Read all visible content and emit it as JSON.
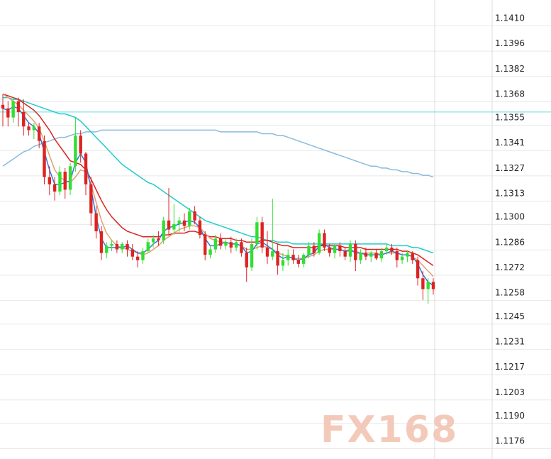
{
  "chart_data": {
    "type": "candlestick",
    "title": "",
    "ylabel": "",
    "xlabel": "",
    "ylim": [
      1.1166,
      1.142
    ],
    "y_ticks": [
      "1.1410",
      "1.1396",
      "1.1382",
      "1.1368",
      "1.1355",
      "1.1341",
      "1.1327",
      "1.1313",
      "1.1300",
      "1.1286",
      "1.1272",
      "1.1258",
      "1.1245",
      "1.1231",
      "1.1217",
      "1.1203",
      "1.1190",
      "1.1176"
    ],
    "grid": true,
    "reference_line": 1.1358,
    "colors": {
      "up": "#33dd33",
      "down": "#dd2222",
      "ma_fast": "#3377dd",
      "ma_mid": "#e0a070",
      "ma_slow": "#dd2222",
      "ma_cyan": "#22cccc",
      "ma_long": "#88bbdd",
      "grid": "#e8e8e8",
      "axis": "#e0e0e0",
      "ref_line": "#66dddd"
    },
    "candles": [
      [
        1.1362,
        1.1368,
        1.135,
        1.136
      ],
      [
        1.136,
        1.1364,
        1.135,
        1.1355
      ],
      [
        1.1355,
        1.1366,
        1.1352,
        1.1364
      ],
      [
        1.1364,
        1.1366,
        1.135,
        1.1358
      ],
      [
        1.1358,
        1.1365,
        1.1345,
        1.135
      ],
      [
        1.135,
        1.1352,
        1.1345,
        1.1348
      ],
      [
        1.1348,
        1.1352,
        1.1343,
        1.135
      ],
      [
        1.135,
        1.1352,
        1.1338,
        1.1342
      ],
      [
        1.1342,
        1.1345,
        1.1318,
        1.1322
      ],
      [
        1.1322,
        1.1328,
        1.1312,
        1.1318
      ],
      [
        1.1318,
        1.1322,
        1.1309,
        1.1314
      ],
      [
        1.1314,
        1.1328,
        1.1312,
        1.1325
      ],
      [
        1.1325,
        1.1327,
        1.131,
        1.1315
      ],
      [
        1.1315,
        1.133,
        1.1312,
        1.1328
      ],
      [
        1.1328,
        1.1355,
        1.1325,
        1.1345
      ],
      [
        1.1345,
        1.1348,
        1.133,
        1.1335
      ],
      [
        1.1335,
        1.1336,
        1.1312,
        1.1318
      ],
      [
        1.1318,
        1.1322,
        1.1295,
        1.1302
      ],
      [
        1.1302,
        1.1306,
        1.1288,
        1.1292
      ],
      [
        1.1292,
        1.1295,
        1.1276,
        1.128
      ],
      [
        1.128,
        1.1286,
        1.1277,
        1.1284
      ],
      [
        1.1284,
        1.1287,
        1.1281,
        1.1285
      ],
      [
        1.1285,
        1.1287,
        1.128,
        1.1282
      ],
      [
        1.1282,
        1.1286,
        1.128,
        1.1285
      ],
      [
        1.1285,
        1.1287,
        1.1278,
        1.1282
      ],
      [
        1.1282,
        1.1285,
        1.1276,
        1.1278
      ],
      [
        1.1278,
        1.1281,
        1.1272,
        1.1276
      ],
      [
        1.1276,
        1.1283,
        1.1274,
        1.1281
      ],
      [
        1.1281,
        1.1288,
        1.128,
        1.1286
      ],
      [
        1.1286,
        1.129,
        1.1283,
        1.1288
      ],
      [
        1.1288,
        1.1292,
        1.1284,
        1.1287
      ],
      [
        1.1287,
        1.13,
        1.1285,
        1.1298
      ],
      [
        1.1298,
        1.1316,
        1.129,
        1.1293
      ],
      [
        1.1293,
        1.1307,
        1.129,
        1.1296
      ],
      [
        1.1296,
        1.13,
        1.1291,
        1.1298
      ],
      [
        1.1298,
        1.1302,
        1.1292,
        1.1295
      ],
      [
        1.1295,
        1.1305,
        1.1293,
        1.1303
      ],
      [
        1.1303,
        1.1306,
        1.1296,
        1.1298
      ],
      [
        1.1298,
        1.13,
        1.1288,
        1.129
      ],
      [
        1.129,
        1.1292,
        1.1276,
        1.1279
      ],
      [
        1.1279,
        1.1284,
        1.1277,
        1.1282
      ],
      [
        1.1282,
        1.129,
        1.128,
        1.1288
      ],
      [
        1.1288,
        1.1291,
        1.1282,
        1.1284
      ],
      [
        1.1284,
        1.1288,
        1.1282,
        1.1286
      ],
      [
        1.1286,
        1.1289,
        1.128,
        1.1283
      ],
      [
        1.1283,
        1.1288,
        1.1281,
        1.1286
      ],
      [
        1.1286,
        1.1288,
        1.1278,
        1.128
      ],
      [
        1.128,
        1.1283,
        1.1264,
        1.1272
      ],
      [
        1.1272,
        1.1288,
        1.127,
        1.1285
      ],
      [
        1.1285,
        1.13,
        1.1282,
        1.1297
      ],
      [
        1.1297,
        1.13,
        1.128,
        1.1283
      ],
      [
        1.1283,
        1.1292,
        1.1274,
        1.1278
      ],
      [
        1.1278,
        1.131,
        1.1276,
        1.1281
      ],
      [
        1.1281,
        1.1285,
        1.1268,
        1.1273
      ],
      [
        1.1273,
        1.128,
        1.127,
        1.1276
      ],
      [
        1.1276,
        1.1282,
        1.1273,
        1.1279
      ],
      [
        1.1279,
        1.1282,
        1.1274,
        1.1276
      ],
      [
        1.1276,
        1.1279,
        1.1272,
        1.1274
      ],
      [
        1.1274,
        1.128,
        1.1272,
        1.1279
      ],
      [
        1.1279,
        1.1286,
        1.1277,
        1.1284
      ],
      [
        1.1284,
        1.1286,
        1.1278,
        1.128
      ],
      [
        1.128,
        1.1293,
        1.1279,
        1.1291
      ],
      [
        1.1291,
        1.1293,
        1.1281,
        1.1283
      ],
      [
        1.1283,
        1.1285,
        1.1278,
        1.128
      ],
      [
        1.128,
        1.1285,
        1.1277,
        1.1284
      ],
      [
        1.1284,
        1.1286,
        1.1278,
        1.1281
      ],
      [
        1.1281,
        1.1283,
        1.1276,
        1.1278
      ],
      [
        1.1278,
        1.1287,
        1.1275,
        1.1285
      ],
      [
        1.1285,
        1.1287,
        1.127,
        1.1276
      ],
      [
        1.1276,
        1.1282,
        1.1274,
        1.128
      ],
      [
        1.128,
        1.1283,
        1.1276,
        1.1278
      ],
      [
        1.1278,
        1.1281,
        1.1275,
        1.128
      ],
      [
        1.128,
        1.1282,
        1.1276,
        1.1277
      ],
      [
        1.1277,
        1.1283,
        1.1275,
        1.1281
      ],
      [
        1.1281,
        1.1285,
        1.1279,
        1.1283
      ],
      [
        1.1283,
        1.1285,
        1.1279,
        1.1281
      ],
      [
        1.1281,
        1.1283,
        1.1272,
        1.1276
      ],
      [
        1.1276,
        1.128,
        1.1274,
        1.1278
      ],
      [
        1.1278,
        1.1281,
        1.1275,
        1.128
      ],
      [
        1.128,
        1.1281,
        1.1274,
        1.1276
      ],
      [
        1.1276,
        1.1278,
        1.1262,
        1.1266
      ],
      [
        1.1266,
        1.127,
        1.1254,
        1.126
      ],
      [
        1.126,
        1.1266,
        1.1252,
        1.1264
      ],
      [
        1.1264,
        1.1266,
        1.1257,
        1.126
      ]
    ],
    "ma_fast": [
      1.136,
      1.1359,
      1.1361,
      1.136,
      1.1356,
      1.1352,
      1.135,
      1.1346,
      1.1336,
      1.1326,
      1.1318,
      1.1318,
      1.1319,
      1.132,
      1.133,
      1.1335,
      1.133,
      1.1316,
      1.13,
      1.1288,
      1.1283,
      1.1283,
      1.1283,
      1.1283,
      1.1284,
      1.1282,
      1.128,
      1.128,
      1.1282,
      1.1285,
      1.1287,
      1.1292,
      1.1294,
      1.1295,
      1.1296,
      1.1297,
      1.1298,
      1.1297,
      1.1294,
      1.1288,
      1.1284,
      1.1284,
      1.1285,
      1.1286,
      1.1285,
      1.1285,
      1.1284,
      1.128,
      1.1281,
      1.1285,
      1.1286,
      1.1284,
      1.1282,
      1.1279,
      1.1277,
      1.1278,
      1.1277,
      1.1276,
      1.1277,
      1.1279,
      1.128,
      1.1284,
      1.1285,
      1.1283,
      1.1282,
      1.1282,
      1.1281,
      1.1282,
      1.128,
      1.128,
      1.1279,
      1.1279,
      1.1279,
      1.1279,
      1.128,
      1.1281,
      1.128,
      1.1279,
      1.1279,
      1.1278,
      1.1274,
      1.1268,
      1.1264,
      1.1262
    ],
    "ma_mid": [
      1.1368,
      1.1366,
      1.1364,
      1.1362,
      1.1359,
      1.1356,
      1.1353,
      1.1349,
      1.1342,
      1.1334,
      1.1326,
      1.1322,
      1.132,
      1.1319,
      1.1322,
      1.1326,
      1.1325,
      1.1318,
      1.1308,
      1.1298,
      1.1291,
      1.1287,
      1.1284,
      1.1283,
      1.1282,
      1.1281,
      1.128,
      1.1279,
      1.128,
      1.1282,
      1.1284,
      1.1287,
      1.1289,
      1.1291,
      1.1293,
      1.1294,
      1.1295,
      1.1295,
      1.1294,
      1.1291,
      1.1288,
      1.1287,
      1.1286,
      1.1286,
      1.1285,
      1.1285,
      1.1284,
      1.1282,
      1.1282,
      1.1283,
      1.1284,
      1.1283,
      1.1282,
      1.128,
      1.1279,
      1.1278,
      1.1277,
      1.1277,
      1.1277,
      1.1278,
      1.1279,
      1.1281,
      1.1282,
      1.1282,
      1.1282,
      1.1282,
      1.1281,
      1.1281,
      1.1281,
      1.128,
      1.128,
      1.128,
      1.128,
      1.1279,
      1.128,
      1.128,
      1.128,
      1.1279,
      1.1279,
      1.1278,
      1.1276,
      1.1273,
      1.127,
      1.1267
    ],
    "ma_slow": [
      1.1368,
      1.1367,
      1.1366,
      1.1365,
      1.1363,
      1.1361,
      1.1359,
      1.1356,
      1.1352,
      1.1348,
      1.1343,
      1.1339,
      1.1335,
      1.1331,
      1.133,
      1.1329,
      1.1326,
      1.1321,
      1.1315,
      1.1309,
      1.1304,
      1.13,
      1.1297,
      1.1294,
      1.1292,
      1.1291,
      1.129,
      1.1289,
      1.1289,
      1.1289,
      1.1289,
      1.129,
      1.129,
      1.1291,
      1.1291,
      1.1291,
      1.1292,
      1.1292,
      1.1291,
      1.129,
      1.1289,
      1.1289,
      1.1288,
      1.1288,
      1.1288,
      1.1287,
      1.1287,
      1.1286,
      1.1286,
      1.1286,
      1.1287,
      1.1287,
      1.1286,
      1.1285,
      1.1284,
      1.1284,
      1.1283,
      1.1283,
      1.1283,
      1.1283,
      1.1283,
      1.1284,
      1.1284,
      1.1284,
      1.1284,
      1.1284,
      1.1283,
      1.1283,
      1.1283,
      1.1283,
      1.1282,
      1.1282,
      1.1282,
      1.1282,
      1.1282,
      1.1282,
      1.1282,
      1.1281,
      1.1281,
      1.128,
      1.1279,
      1.1277,
      1.1275,
      1.1273
    ],
    "ma_cyan": [
      1.1366,
      1.1366,
      1.1365,
      1.1365,
      1.1364,
      1.1363,
      1.1362,
      1.1361,
      1.136,
      1.1359,
      1.1358,
      1.1357,
      1.1357,
      1.1356,
      1.1355,
      1.1353,
      1.135,
      1.1347,
      1.1344,
      1.1341,
      1.1338,
      1.1335,
      1.1332,
      1.1329,
      1.1327,
      1.1325,
      1.1323,
      1.1321,
      1.1319,
      1.1318,
      1.1316,
      1.1314,
      1.1312,
      1.131,
      1.1308,
      1.1306,
      1.1304,
      1.1302,
      1.13,
      1.1298,
      1.1297,
      1.1296,
      1.1295,
      1.1294,
      1.1293,
      1.1292,
      1.1291,
      1.129,
      1.1289,
      1.1289,
      1.1288,
      1.1287,
      1.1287,
      1.1286,
      1.1286,
      1.1286,
      1.1285,
      1.1285,
      1.1285,
      1.1285,
      1.1285,
      1.1285,
      1.1285,
      1.1285,
      1.1285,
      1.1285,
      1.1285,
      1.1285,
      1.1285,
      1.1285,
      1.1285,
      1.1285,
      1.1285,
      1.1285,
      1.1285,
      1.1284,
      1.1284,
      1.1284,
      1.1284,
      1.1283,
      1.1283,
      1.1282,
      1.1281,
      1.128
    ],
    "ma_long": [
      1.1328,
      1.133,
      1.1332,
      1.1334,
      1.1336,
      1.1337,
      1.1339,
      1.134,
      1.1341,
      1.1342,
      1.1343,
      1.1344,
      1.1344,
      1.1345,
      1.1346,
      1.1346,
      1.1347,
      1.1347,
      1.1347,
      1.1348,
      1.1348,
      1.1348,
      1.1348,
      1.1348,
      1.1348,
      1.1348,
      1.1348,
      1.1348,
      1.1348,
      1.1348,
      1.1348,
      1.1348,
      1.1348,
      1.1348,
      1.1348,
      1.1348,
      1.1348,
      1.1348,
      1.1348,
      1.1348,
      1.1348,
      1.1348,
      1.1347,
      1.1347,
      1.1347,
      1.1347,
      1.1347,
      1.1347,
      1.1347,
      1.1347,
      1.1346,
      1.1346,
      1.1346,
      1.1345,
      1.1345,
      1.1344,
      1.1343,
      1.1342,
      1.1341,
      1.134,
      1.1339,
      1.1338,
      1.1337,
      1.1336,
      1.1335,
      1.1334,
      1.1333,
      1.1332,
      1.1331,
      1.133,
      1.1329,
      1.1328,
      1.1328,
      1.1327,
      1.1327,
      1.1326,
      1.1326,
      1.1325,
      1.1325,
      1.1324,
      1.1324,
      1.1323,
      1.1323,
      1.1322
    ]
  },
  "watermark": {
    "text": "FX168"
  }
}
